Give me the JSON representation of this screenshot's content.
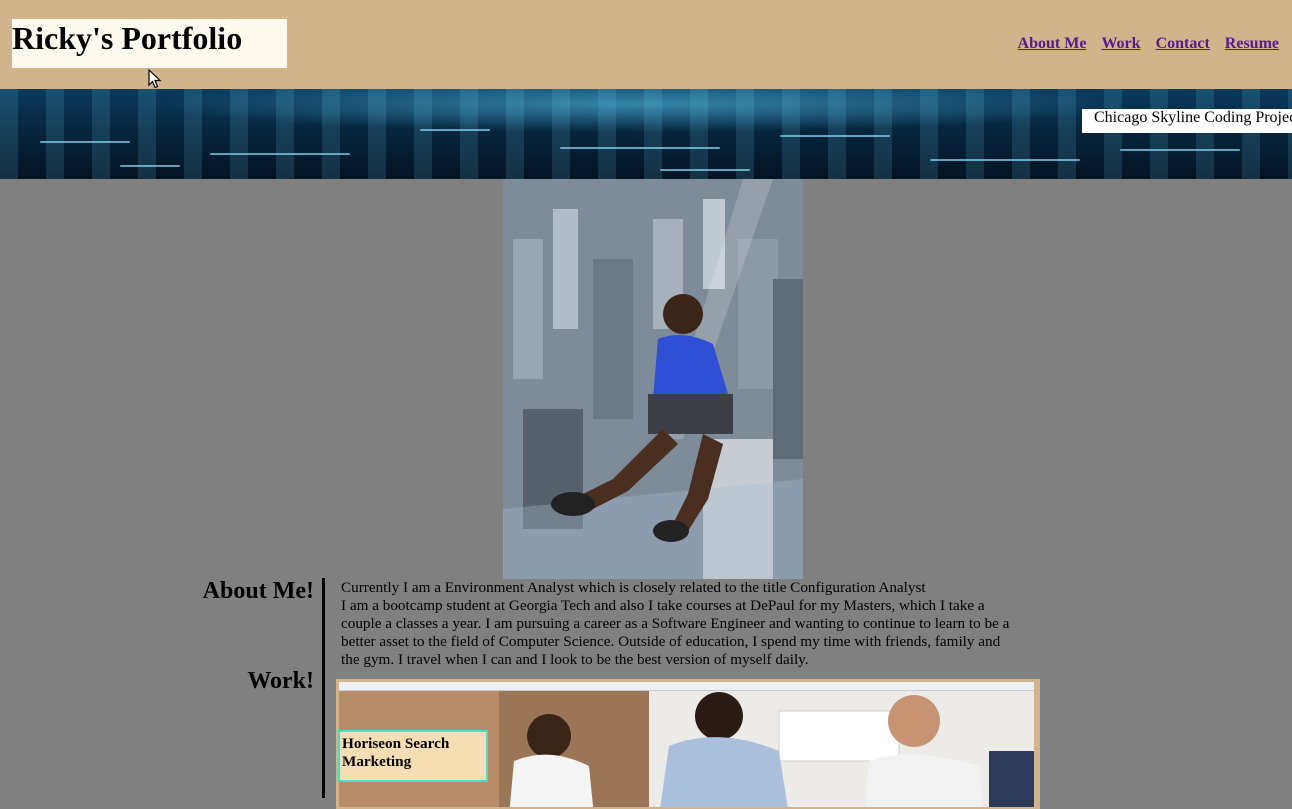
{
  "header": {
    "title": "Ricky's Portfolio",
    "nav": [
      {
        "label": "About Me"
      },
      {
        "label": "Work"
      },
      {
        "label": "Contact"
      },
      {
        "label": "Resume"
      }
    ]
  },
  "banner": {
    "caption": "Chicago Skyline Coding Project"
  },
  "sections": {
    "about_heading": "About Me!",
    "work_heading": "Work!"
  },
  "about": {
    "line1": "Currently I am a Environment Analyst which is closely related to the title Configuration Analyst",
    "line2": "I am a bootcamp student at Georgia Tech and also I take courses at DePaul for my Masters, which I take a couple a classes a year. I am pursuing a career as a Software Engineer and wanting to continue to learn to be a better asset to the field of Computer Science. Outside of education, I spend my time with friends, family and the gym. I travel when I can and I look to be the best version of myself daily."
  },
  "work": {
    "items": [
      {
        "label": "Horiseon Search Marketing"
      }
    ]
  },
  "colors": {
    "header_bg": "#d2b48c",
    "title_bg": "#fffaf0",
    "page_bg": "#808080",
    "link": "#551a8b",
    "work_label_bg": "#f5deb3",
    "work_label_border": "#40e0d0"
  }
}
